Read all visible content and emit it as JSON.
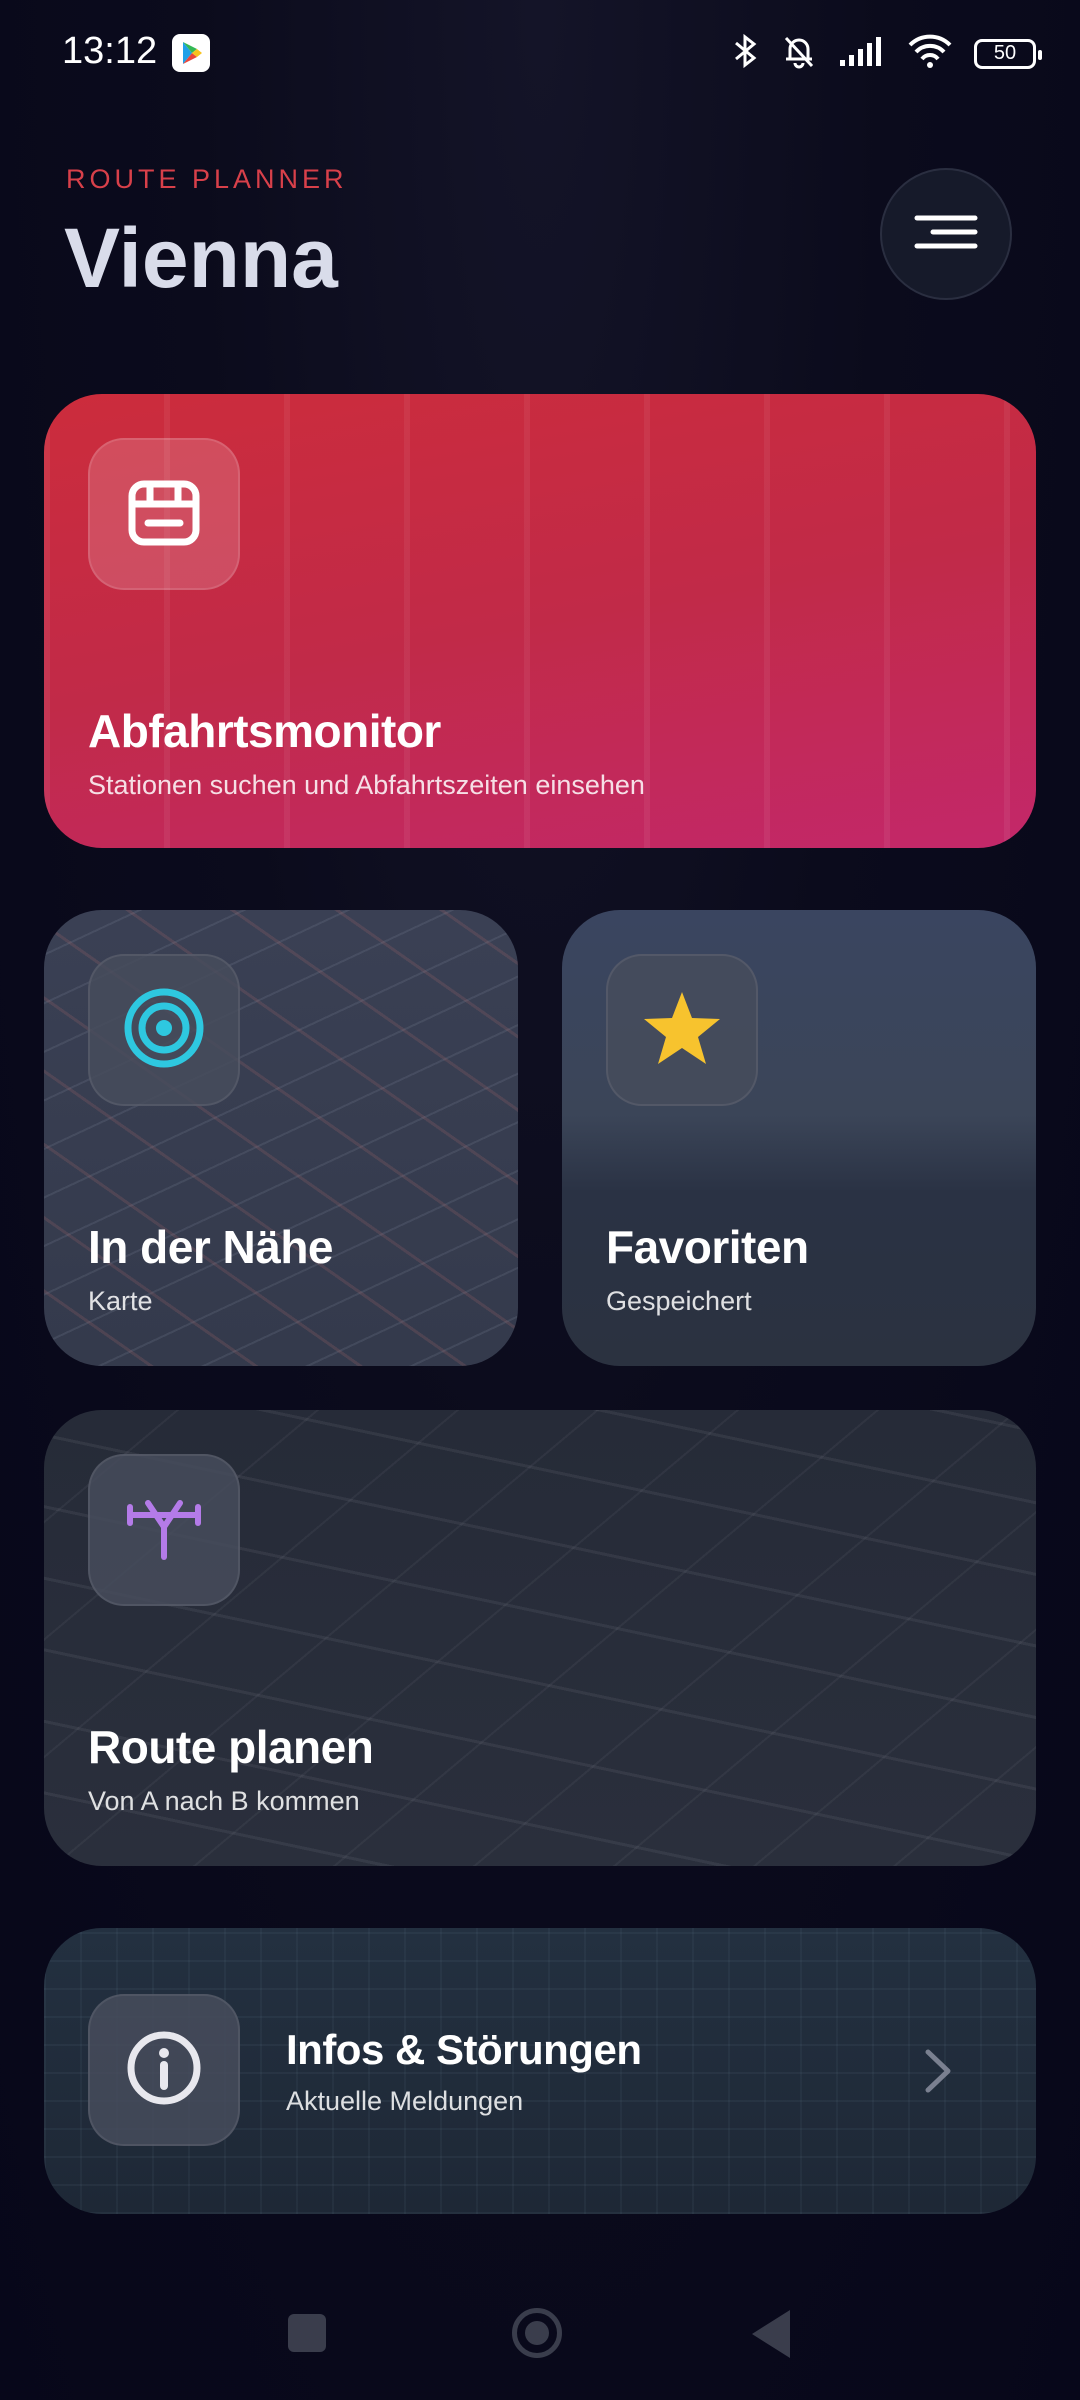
{
  "status_bar": {
    "time": "13:12",
    "battery": "50",
    "icons": [
      "google-play-icon",
      "bluetooth-icon",
      "bell-off-icon",
      "signal-icon",
      "wifi-icon",
      "battery-icon"
    ]
  },
  "header": {
    "eyebrow": "ROUTE PLANNER",
    "city": "Vienna",
    "menu_icon": "menu-icon"
  },
  "cards": {
    "departures": {
      "title": "Abfahrtsmonitor",
      "subtitle": "Stationen suchen und Abfahrtszeiten einsehen",
      "icon": "calendar-board-icon"
    },
    "nearby": {
      "title": "In der Nähe",
      "subtitle": "Karte",
      "icon": "target-icon",
      "icon_color": "#2ec8e0"
    },
    "favorites": {
      "title": "Favoriten",
      "subtitle": "Gespeichert",
      "icon": "star-icon",
      "icon_color": "#f7c32e"
    },
    "route": {
      "title": "Route planen",
      "subtitle": "Von A nach B kommen",
      "icon": "route-split-icon",
      "icon_color": "#b47be8"
    },
    "info": {
      "title": "Infos & Störungen",
      "subtitle": "Aktuelle Meldungen",
      "icon": "info-icon",
      "chevron": "chevron-right-icon"
    }
  },
  "colors": {
    "accent_red": "#d8404a",
    "background": "#0b0b1c"
  },
  "nav": {
    "icons": [
      "recent-apps-icon",
      "home-icon",
      "back-icon"
    ]
  }
}
